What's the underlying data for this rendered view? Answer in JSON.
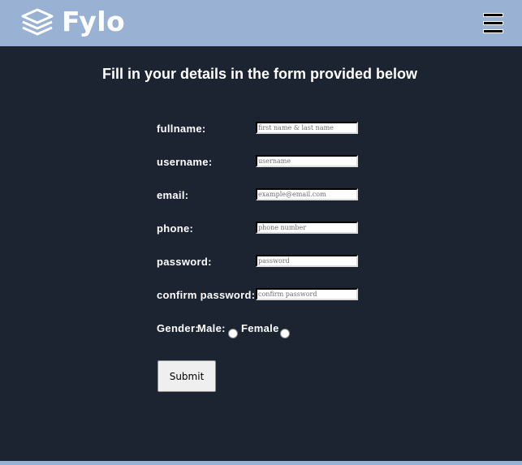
{
  "header": {
    "brand": "Fylo",
    "logo_icon": "stacked-layers-icon",
    "menu_icon": "hamburger-menu-icon",
    "background": "#99b1d3"
  },
  "main": {
    "title": "Fill in your details in the form provided below",
    "background": "#1c2331"
  },
  "form": {
    "fields": [
      {
        "label": "fullname:",
        "placeholder": "first name & last name"
      },
      {
        "label": "username:",
        "placeholder": "username"
      },
      {
        "label": "email:",
        "placeholder": "example@email.com"
      },
      {
        "label": "phone:",
        "placeholder": "phone number"
      },
      {
        "label": "password:",
        "placeholder": "password"
      },
      {
        "label": "confirm password:",
        "placeholder": "confirm password"
      }
    ],
    "gender": {
      "label": "Gender:",
      "male_label": "Male:",
      "female_label": "Female"
    },
    "submit_label": "Submit"
  }
}
